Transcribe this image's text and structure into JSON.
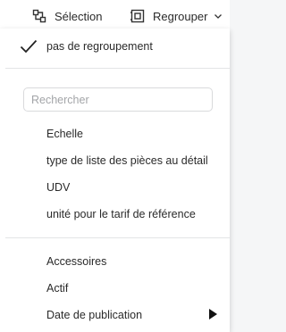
{
  "toolbar": {
    "selection_label": "Sélection",
    "group_label": "Regrouper"
  },
  "menu": {
    "no_grouping": "pas de regroupement",
    "search_placeholder": "Rechercher",
    "attributes": [
      "Echelle",
      "type de liste des pièces au détail",
      "UDV",
      "unité pour le tarif de référence"
    ],
    "categories": [
      "Accessoires",
      "Actif",
      "Date de publication"
    ]
  }
}
